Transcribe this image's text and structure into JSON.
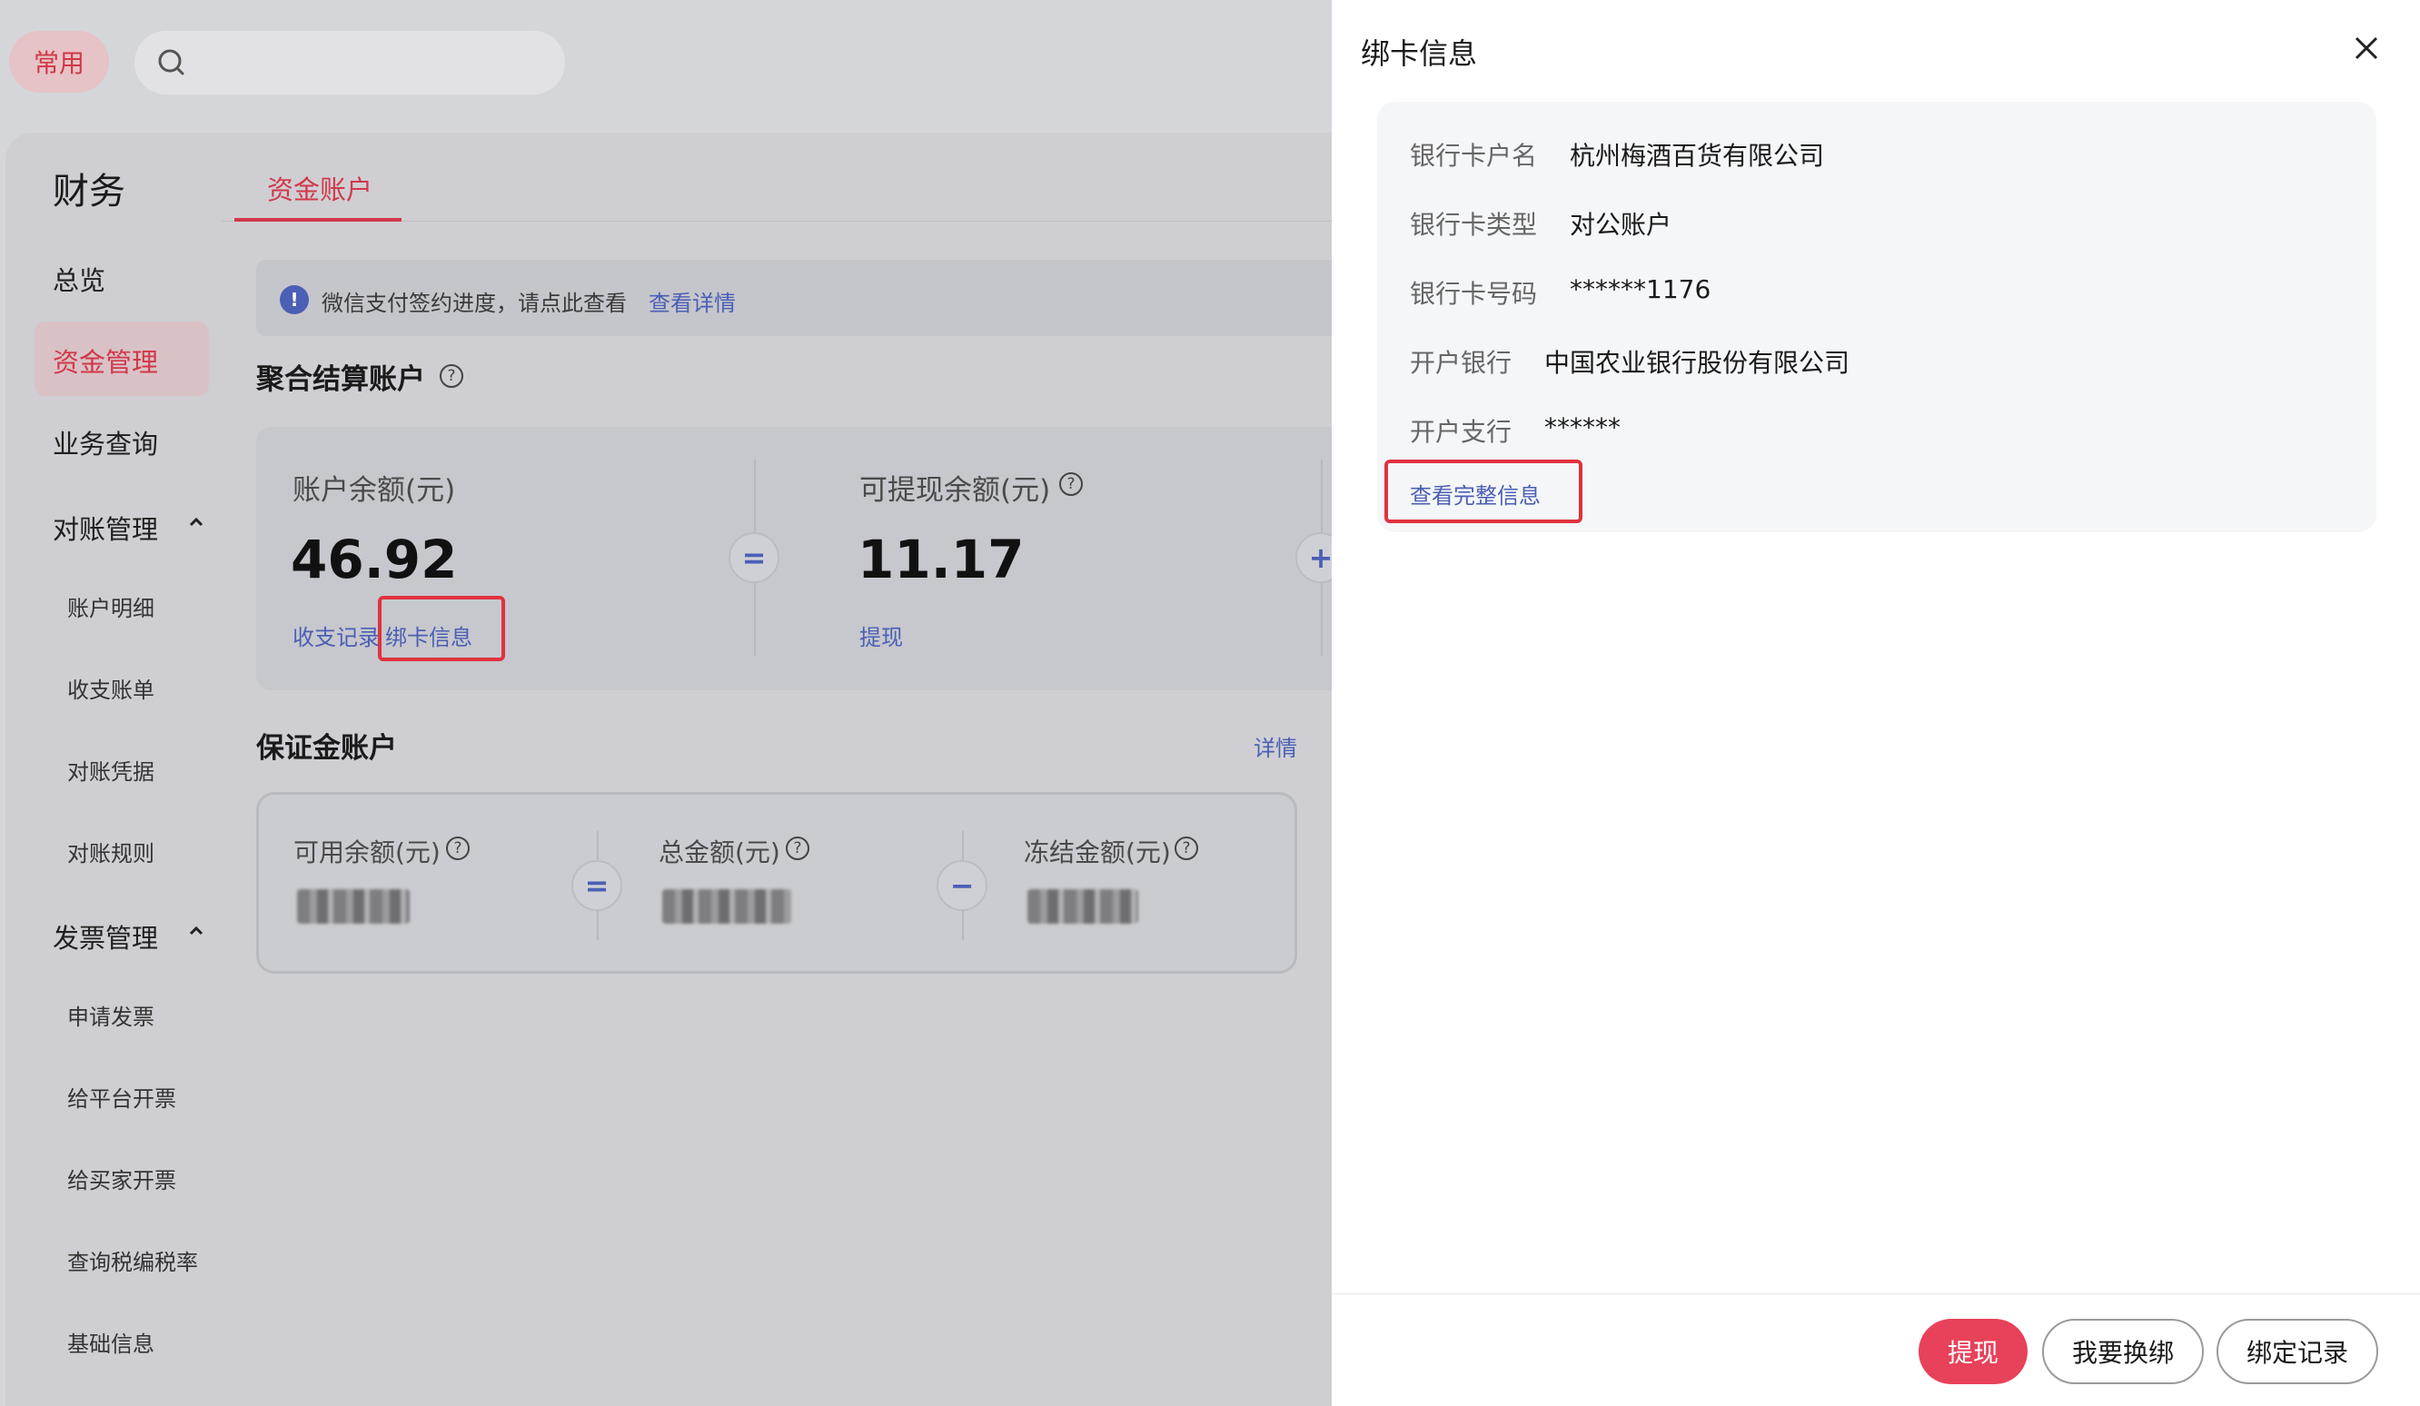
{
  "topbar": {
    "tag_label": "常用",
    "search_placeholder": ""
  },
  "sidebar": {
    "title": "财务",
    "items": [
      {
        "label": "总览"
      },
      {
        "label": "资金管理",
        "active": true
      },
      {
        "label": "业务查询"
      },
      {
        "label": "对账管理",
        "expanded": true
      },
      {
        "label": "账户明细"
      },
      {
        "label": "收支账单"
      },
      {
        "label": "对账凭据"
      },
      {
        "label": "对账规则"
      },
      {
        "label": "发票管理",
        "expanded": true
      },
      {
        "label": "申请发票"
      },
      {
        "label": "给平台开票"
      },
      {
        "label": "给买家开票"
      },
      {
        "label": "查询税编税率"
      },
      {
        "label": "基础信息"
      }
    ]
  },
  "tabs": {
    "active_label": "资金账户"
  },
  "notice": {
    "text": "微信支付签约进度，请点此查看",
    "link": "查看详情"
  },
  "aggregate": {
    "title": "聚合结算账户",
    "balance_label": "账户余额(元)",
    "balance_value": "46.92",
    "records_link": "收支记录",
    "bind_link": "绑卡信息",
    "withdrawable_label": "可提现余额(元)",
    "withdrawable_value": "11.17",
    "withdraw_link": "提现",
    "op_equal": "=",
    "op_plus": "+"
  },
  "deposit": {
    "title": "保证金账户",
    "detail_link": "详情",
    "available_label": "可用余额(元)",
    "total_label": "总金额(元)",
    "frozen_label": "冻结金额(元)",
    "op_equal": "=",
    "op_minus": "−"
  },
  "drawer": {
    "title": "绑卡信息",
    "rows": [
      {
        "label": "银行卡户名",
        "value": "杭州梅酒百货有限公司"
      },
      {
        "label": "银行卡类型",
        "value": "对公账户"
      },
      {
        "label": "银行卡号码",
        "value": "******1176"
      },
      {
        "label": "开户银行",
        "value": "中国农业银行股份有限公司"
      },
      {
        "label": "开户支行",
        "value": "******"
      }
    ],
    "full_info_link": "查看完整信息",
    "buttons": {
      "withdraw": "提现",
      "rebind": "我要换绑",
      "records": "绑定记录"
    }
  },
  "colors": {
    "accent": "#e8415a",
    "link": "#4a5fb5",
    "highlight_box": "#e0323e"
  }
}
